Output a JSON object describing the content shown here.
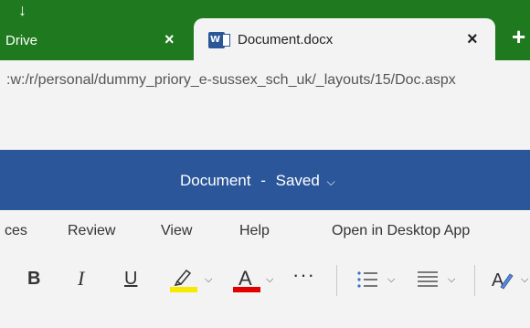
{
  "tabs": {
    "inactive_label": "Drive",
    "active_label": "Document.docx",
    "close_glyph": "×",
    "new_tab_glyph": "+",
    "download_glyph": "↓"
  },
  "address": {
    "url": ":w:/r/personal/dummy_priory_e-sussex_sch_uk/_layouts/15/Doc.aspx"
  },
  "titlebar": {
    "doc_name": "Document",
    "separator": "-",
    "status": "Saved",
    "chevron": "⌵"
  },
  "ribbon": {
    "tabs": [
      "ces",
      "Review",
      "View",
      "Help",
      "Open in Desktop App"
    ]
  },
  "toolbar": {
    "bold": "B",
    "italic": "I",
    "underline": "U",
    "font_color_letter": "A",
    "more": "···",
    "chevron": "⌵",
    "highlight_color": "#f7ea00",
    "font_color": "#e00000"
  },
  "colors": {
    "tabstrip": "#1f7a1f",
    "titlebar": "#2b579a",
    "background": "#f3f3f3"
  }
}
